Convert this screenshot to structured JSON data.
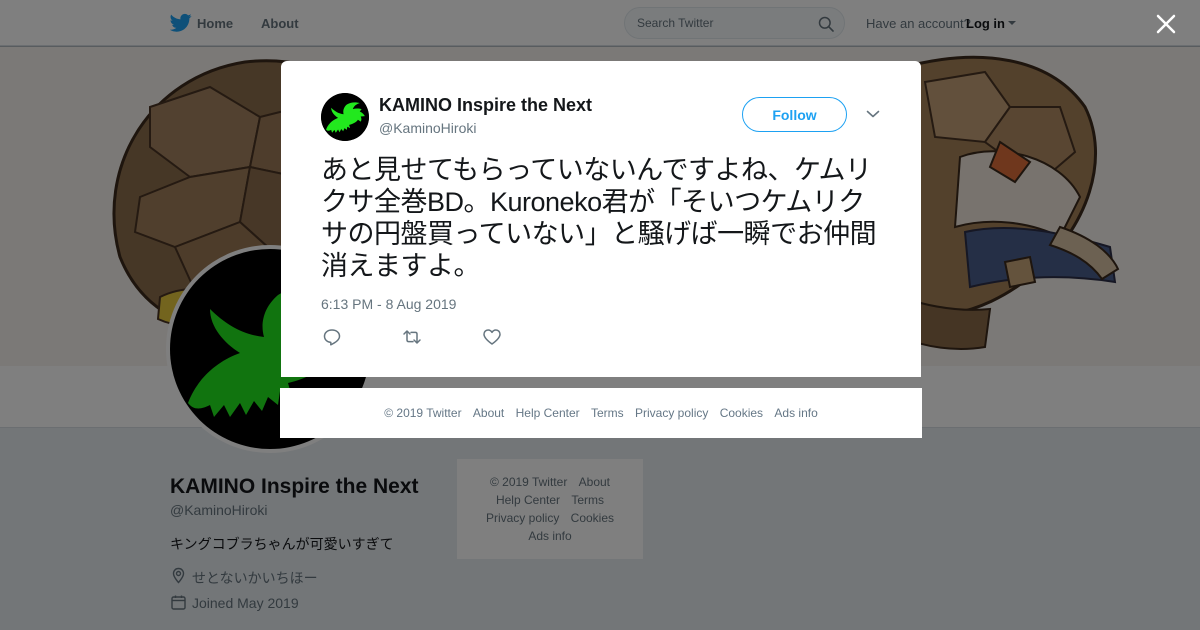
{
  "topbar": {
    "logo_icon": "twitter-bird-icon",
    "home_label": "Home",
    "about_label": "About",
    "search_placeholder": "Search Twitter",
    "search_icon": "search-icon",
    "account_prompt": "Have an account?",
    "login_label": "Log in"
  },
  "profile": {
    "name": "KAMINO Inspire the Next",
    "handle": "@KaminoHiroki",
    "bio": "キングコブラちゃんが可愛いすぎて",
    "location": "せとないかいちほー",
    "joined": "Joined May 2019"
  },
  "side_footer": {
    "items": [
      "© 2019 Twitter",
      "About",
      "Help Center",
      "Terms",
      "Privacy policy",
      "Cookies",
      "Ads info"
    ]
  },
  "modal": {
    "author_name": "KAMINO Inspire the Next",
    "author_handle": "@KaminoHiroki",
    "follow_label": "Follow",
    "tweet_text": "あと見せてもらっていないんですよね、ケムリクサ全巻BD。Kuroneko君が「そいつケムリクサの円盤買っていない」と騒げば一瞬でお仲間消えますよ。",
    "timestamp": "6:13 PM - 8 Aug 2019",
    "actions": [
      "reply-icon",
      "retweet-icon",
      "like-icon"
    ]
  },
  "modal_footer": {
    "items": [
      "© 2019 Twitter",
      "About",
      "Help Center",
      "Terms",
      "Privacy policy",
      "Cookies",
      "Ads info"
    ]
  },
  "colors": {
    "brand_blue": "#1da1f2",
    "avatar_green": "#22e81e",
    "text_primary": "#14171a",
    "text_secondary": "#66757f"
  }
}
